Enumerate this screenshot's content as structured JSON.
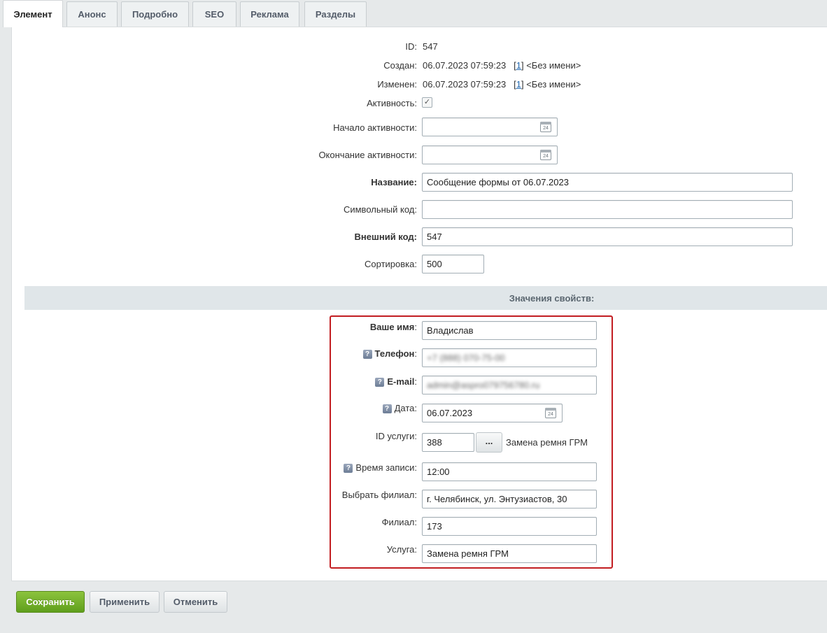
{
  "tabs": [
    "Элемент",
    "Анонс",
    "Подробно",
    "SEO",
    "Реклама",
    "Разделы"
  ],
  "fields": {
    "id_label": "ID:",
    "id_value": "547",
    "created_label": "Создан:",
    "created_value": "06.07.2023 07:59:23",
    "created_user_id": "1",
    "created_user_name": "<Без имени>",
    "modified_label": "Изменен:",
    "modified_value": "06.07.2023 07:59:23",
    "modified_user_id": "1",
    "modified_user_name": "<Без имени>",
    "active_label": "Активность:",
    "active_start_label": "Начало активности:",
    "active_end_label": "Окончание активности:",
    "name_label": "Название:",
    "name_value": "Сообщение формы от 06.07.2023",
    "code_label": "Символьный код:",
    "xml_id_label": "Внешний код:",
    "xml_id_value": "547",
    "sort_label": "Сортировка:",
    "sort_value": "500"
  },
  "properties": {
    "section_title": "Значения свойств:",
    "your_name_label": "Ваше имя",
    "your_name_value": "Владислав",
    "phone_label": "Телефон",
    "phone_value": "+7 (888) 070-75-00",
    "email_label": "E-mail",
    "email_value": "admin@aspro079756780.ru",
    "date_label": "Дата",
    "date_value": "06.07.2023",
    "service_id_label": "ID услуги:",
    "service_id_value": "388",
    "browse_button": "...",
    "service_id_name": "Замена ремня ГРМ",
    "time_label": "Время записи:",
    "time_value": "12:00",
    "branch_select_label": "Выбрать филиал:",
    "branch_select_value": "г. Челябинск, ул. Энтузиастов, 30",
    "branch_label": "Филиал:",
    "branch_value": "173",
    "service_label": "Услуга:",
    "service_value": "Замена ремня ГРМ",
    "help_glyph": "?",
    "colon": ":",
    "calendar_day": "24"
  },
  "buttons": {
    "save": "Сохранить",
    "apply": "Применить",
    "cancel": "Отменить"
  },
  "colors": {
    "save_button": "#6fae27",
    "highlight_border": "#c21d21",
    "section_header_bg": "#e0e6e9",
    "link": "#2067b0"
  }
}
